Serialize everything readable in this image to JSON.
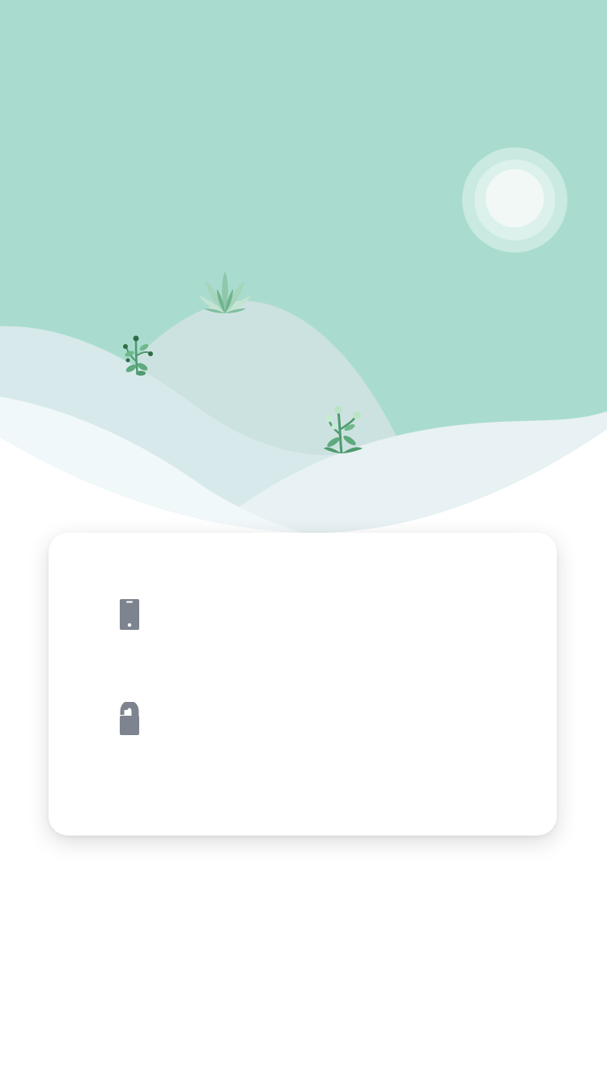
{
  "hero": {
    "illustration": "landscape-hills-sun-plants",
    "sky_color": "#a9dccf",
    "sun_color": "#f1f8f6"
  },
  "login_card": {
    "phone_field": {
      "icon": "mobile-phone-icon",
      "value": "",
      "placeholder": ""
    },
    "password_field": {
      "icon": "padlock-icon",
      "value": "",
      "placeholder": ""
    },
    "icon_color": "#7e848f"
  }
}
